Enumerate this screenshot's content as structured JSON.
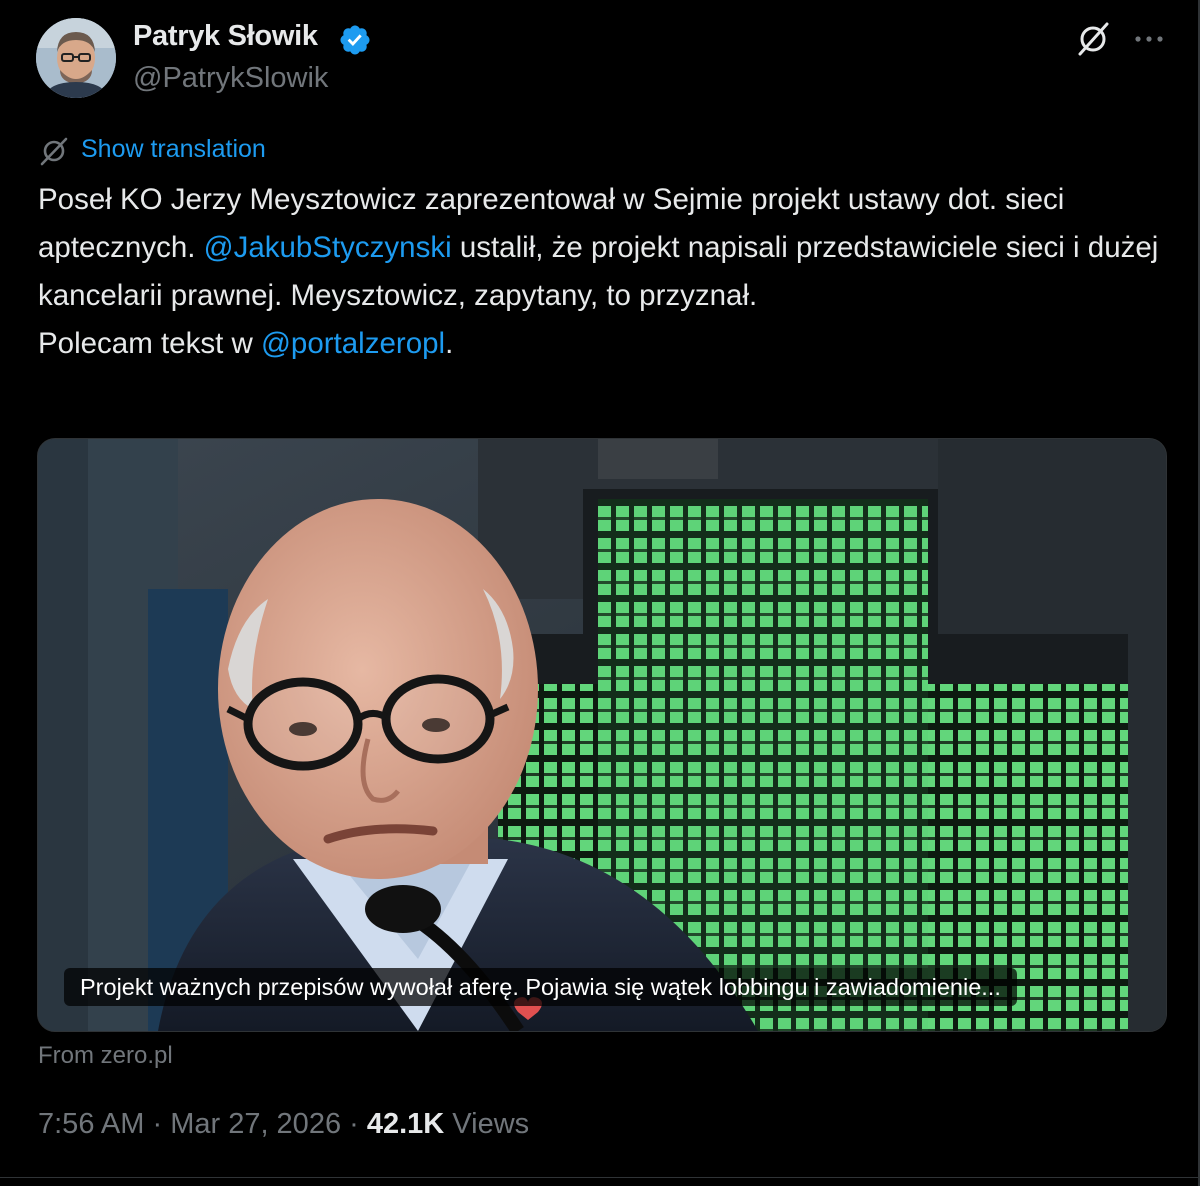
{
  "author": {
    "name": "Patryk Słowik",
    "handle": "@PatrykSlowik",
    "verified_color": "#1d9bf0"
  },
  "header_icons": [
    "grok-icon",
    "more-icon"
  ],
  "translation": {
    "label": "Show translation",
    "icon": "translate-icon"
  },
  "tweet": {
    "segments": [
      {
        "text": "Poseł KO Jerzy Meysztowicz zaprezentował w Sejmie projekt ustawy dot. sieci aptecznych. ",
        "type": "text"
      },
      {
        "text": "@JakubStyczynski",
        "type": "mention"
      },
      {
        "text": " ustalił, że projekt napisali przedstawiciele sieci i dużej kancelarii prawnej. Meysztowicz, zapytany, to przyznał.\nPolecam tekst w ",
        "type": "text"
      },
      {
        "text": "@portalzeropl",
        "type": "mention"
      },
      {
        "text": ".",
        "type": "text"
      }
    ]
  },
  "media": {
    "caption": "Projekt ważnych przepisów wywołał aferę. Pojawia się wątek lobbingu i zawiadomienie...",
    "source": "From zero.pl"
  },
  "meta": {
    "time": "7:56 AM",
    "separator1": " · ",
    "date": "Mar 27, 2026",
    "separator2": " · ",
    "views_count": "42.1K",
    "views_label": " Views"
  },
  "colors": {
    "background": "#000000",
    "text": "#e7e9ea",
    "muted": "#71767b",
    "accent": "#1d9bf0",
    "pharmacy_green": "#5fd37a"
  }
}
